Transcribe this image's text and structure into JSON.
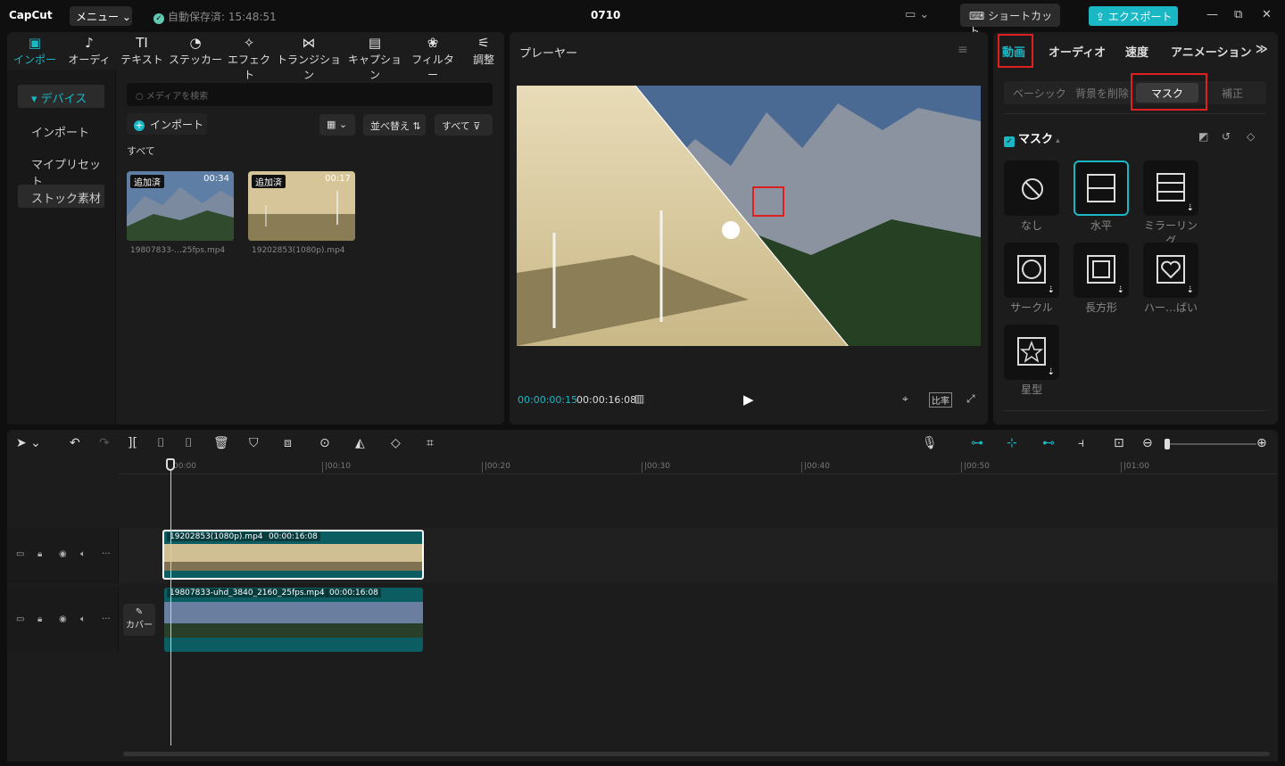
{
  "titlebar": {
    "logo": "CapCut",
    "menu_label": "メニュー ⌄",
    "autosave": "自動保存済: 15:48:51",
    "project_name": "0710",
    "shortcut_label": "ショートカット",
    "export_label": "エクスポート"
  },
  "media_tabs": [
    {
      "icon": "▣",
      "label": "インポート"
    },
    {
      "icon": "♪",
      "label": "オーディオ"
    },
    {
      "icon": "TI",
      "label": "テキスト"
    },
    {
      "icon": "◔",
      "label": "ステッカー"
    },
    {
      "icon": "✧",
      "label": "エフェクト"
    },
    {
      "icon": "⋈",
      "label": "トランジション"
    },
    {
      "icon": "▤",
      "label": "キャプション"
    },
    {
      "icon": "❀",
      "label": "フィルター"
    },
    {
      "icon": "⚟",
      "label": "調整"
    }
  ],
  "sidebar": {
    "items": [
      "▾ デバイス",
      "インポート",
      "マイプリセット",
      "ストック素材"
    ]
  },
  "media": {
    "search_placeholder": "メディアを検索",
    "import_label": "インポート",
    "sort_label": "並べ替え",
    "filter_label": "すべて",
    "all_label": "すべて",
    "thumbs": [
      {
        "tag": "追加済",
        "duration": "00:34",
        "name": "19807833-…25fps.mp4"
      },
      {
        "tag": "追加済",
        "duration": "00:17",
        "name": "19202853(1080p).mp4"
      }
    ]
  },
  "player": {
    "title": "プレーヤー",
    "current_time": "00:00:00:15",
    "total_time": "00:00:16:08",
    "ratio_label": "比率"
  },
  "props": {
    "tabs": [
      "動画",
      "オーディオ",
      "速度",
      "アニメーション"
    ],
    "subtabs": [
      "ベーシック",
      "背景を削除",
      "マスク",
      "補正"
    ],
    "mask_header": "マスク",
    "masks": [
      "なし",
      "水平",
      "ミラーリング",
      "サークル",
      "長方形",
      "ハー…ばい",
      "星型"
    ]
  },
  "timeline": {
    "ticks": [
      "00:00",
      "|00:10",
      "|00:20",
      "|00:30",
      "|00:40",
      "|00:50",
      "|01:00"
    ],
    "clip1_name": "19202853(1080p).mp4",
    "clip1_duration": "00:00:16:08",
    "clip2_name": "19807833-uhd_3840_2160_25fps.mp4",
    "clip2_duration": "00:00:16:08",
    "cover_label": "カバー"
  },
  "colors": {
    "accent": "#1ab7c4",
    "highlight": "#e02020",
    "panel": "#1c1c1c"
  }
}
